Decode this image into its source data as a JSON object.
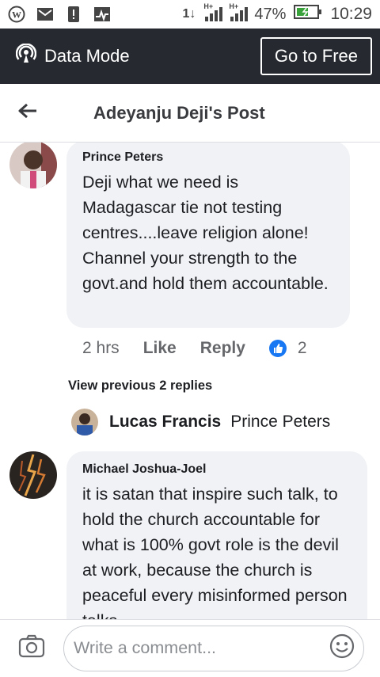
{
  "status_bar": {
    "network": "1↓",
    "signal1_label": "H+",
    "signal2_label": "H+",
    "battery": "47%",
    "time": "10:29"
  },
  "data_bar": {
    "label": "Data Mode",
    "button": "Go to Free"
  },
  "header": {
    "title": "Adeyanju Deji's Post"
  },
  "comments": [
    {
      "author": "Prince Peters",
      "text": "Deji what we need is Madagascar tie not testing centres....leave religion alone! Channel your strength to the govt.and hold them accountable.",
      "time": "2 hrs",
      "like": "Like",
      "reply": "Reply",
      "reactions": "2"
    },
    {
      "author": "Michael Joshua-Joel",
      "text": "it is satan that inspire such talk, to hold the church accountable for what is 100% govt role is the devil at work, because the church is peaceful every misinformed person talks"
    }
  ],
  "view_previous": "View previous 2 replies",
  "reply_preview": {
    "author": "Lucas Francis",
    "text": "Prince Peters"
  },
  "composer": {
    "placeholder": "Write a comment..."
  }
}
